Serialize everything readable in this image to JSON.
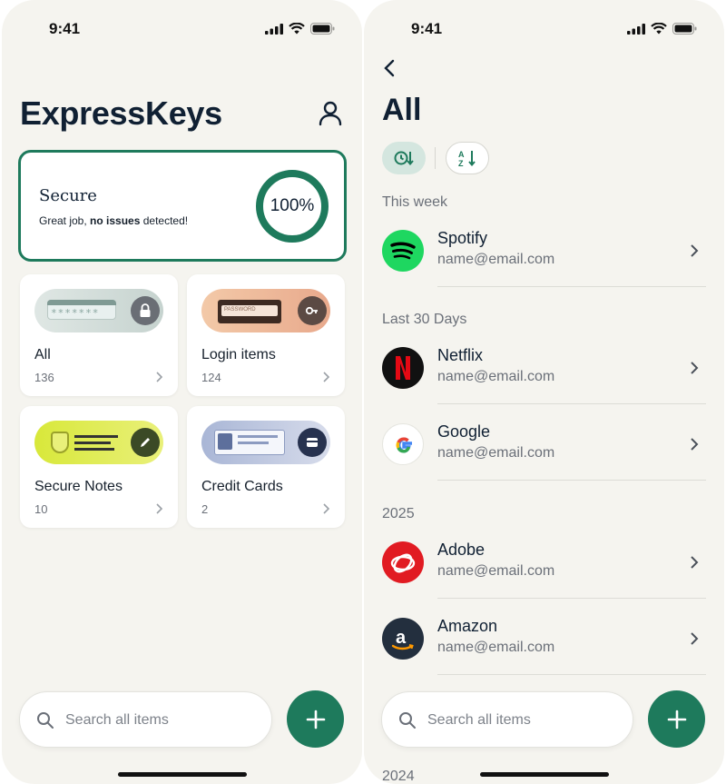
{
  "status_bar": {
    "time": "9:41"
  },
  "home": {
    "title": "ExpressKeys",
    "security": {
      "status": "Secure",
      "message_prefix": "Great job, ",
      "message_bold": "no issues",
      "message_suffix": " detected!",
      "score": "100%"
    },
    "categories": [
      {
        "label": "All",
        "count": "136",
        "icon": "lock-icon"
      },
      {
        "label": "Login items",
        "count": "124",
        "icon": "key-icon"
      },
      {
        "label": "Secure Notes",
        "count": "10",
        "icon": "pen-icon"
      },
      {
        "label": "Credit Cards",
        "count": "2",
        "icon": "credit-card-icon"
      }
    ],
    "illustration_text": {
      "password_mask": "*******",
      "password_label": "PASSWORD"
    },
    "search": {
      "placeholder": "Search all items"
    }
  },
  "list": {
    "title": "All",
    "sort_options": [
      "sort-by-recent-icon",
      "sort-alphabetical-icon"
    ],
    "sections": [
      {
        "header": "This week",
        "items": [
          {
            "name": "Spotify",
            "email": "name@email.com"
          }
        ]
      },
      {
        "header": "Last 30 Days",
        "items": [
          {
            "name": "Netflix",
            "email": "name@email.com"
          },
          {
            "name": "Google",
            "email": "name@email.com"
          }
        ]
      },
      {
        "header": "2025",
        "items": [
          {
            "name": "Adobe",
            "email": "name@email.com"
          },
          {
            "name": "Amazon",
            "email": "name@email.com"
          }
        ]
      },
      {
        "header": "2024",
        "items": []
      }
    ],
    "search": {
      "placeholder": "Search all items"
    }
  },
  "colors": {
    "accent": "#1e7a5c",
    "background": "#f5f4ef",
    "spotify": "#1ed760",
    "netflix": "#e50914",
    "adobe": "#e11b22",
    "amazon": "#232f3e"
  }
}
